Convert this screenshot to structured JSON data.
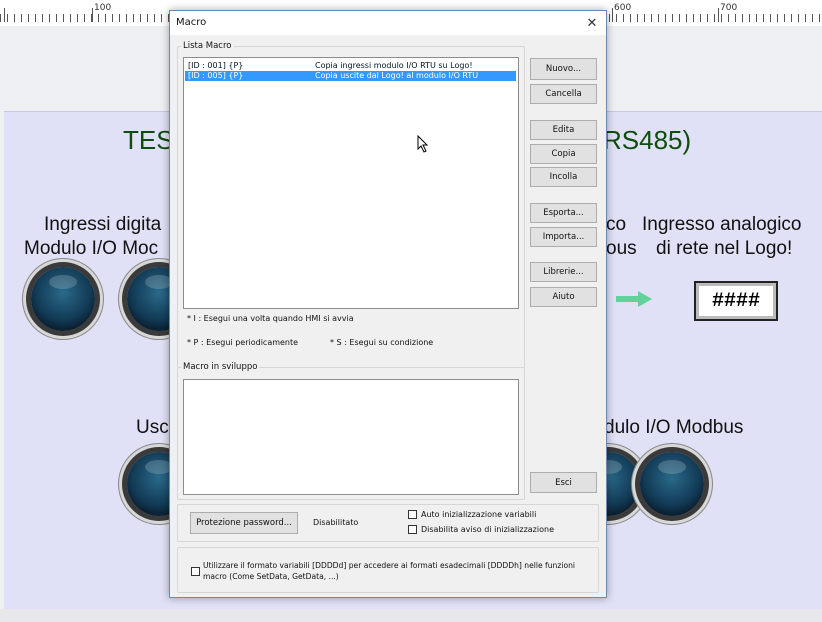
{
  "ruler": {
    "marks": [
      "100",
      "600",
      "700"
    ]
  },
  "background": {
    "title_left": "TES",
    "title_right": "RS485)",
    "inputs_line1": "Ingressi digita",
    "inputs_line2": "Modulo I/O Moc",
    "mid_line1": "co",
    "mid_line2": "ous",
    "analog_line1": "Ingresso analogico",
    "analog_line2": "di rete nel Logo!",
    "outputs_left": "Usc",
    "outputs_right": "dulo I/O Modbus",
    "numeric_value": "####",
    "arrow_color": "#5fd39a"
  },
  "dialog": {
    "title": "Macro",
    "close_label": "✕",
    "macro_list": {
      "label": "Lista Macro",
      "rows": [
        {
          "id": "[ID : 001] {P}",
          "description": "Copia ingressi modulo I/O RTU su Logo!",
          "selected": false
        },
        {
          "id": "[ID : 005] {P}",
          "description": "Copia uscite dal Logo! al modulo I/O RTU",
          "selected": true
        }
      ]
    },
    "buttons": {
      "new": "Nuovo...",
      "delete": "Cancella",
      "edit": "Edita",
      "copy": "Copia",
      "paste": "Incolla",
      "export": "Esporta...",
      "import": "Importa...",
      "library": "Librerie...",
      "help": "Aiuto",
      "exit": "Esci"
    },
    "legend": {
      "i": "* I : Esegui una volta quando HMI si avvia",
      "p": "* P : Esegui periodicamente",
      "s": "* S : Esegui su condizione"
    },
    "dev_macros": {
      "label": "Macro in sviluppo"
    },
    "password": {
      "button": "Protezione password...",
      "status": "Disabilitato",
      "auto_init_label": "Auto inizializzazione variabili",
      "disable_warning_label": "Disabilita aviso di inizializzazione"
    },
    "format": {
      "line1": "Utilizzare il formato variabili [DDDDd] per accedere ai formati esadecimali [DDDDh] nelle funzioni",
      "line2": "macro (Come SetData, GetData, ...)"
    }
  }
}
